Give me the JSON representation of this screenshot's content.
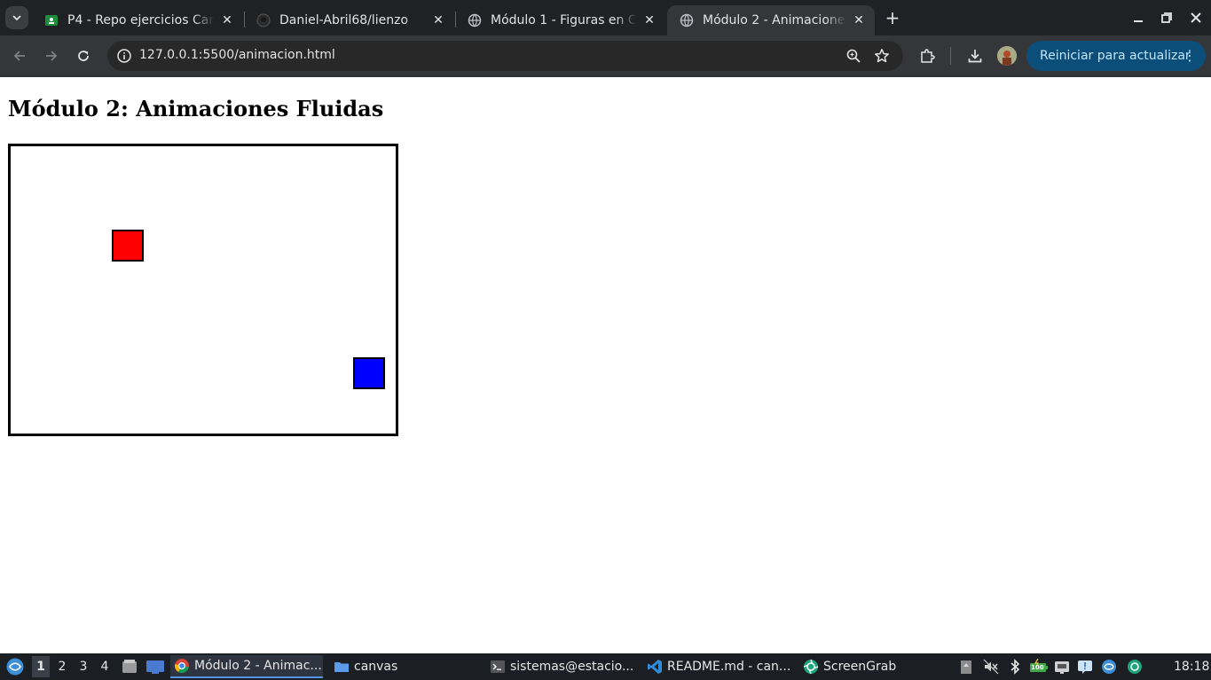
{
  "browser": {
    "tabs": [
      {
        "title": "P4 - Repo ejercicios Canv",
        "icon": "classroom-icon",
        "active": false
      },
      {
        "title": "Daniel-Abril68/lienzo",
        "icon": "github-icon",
        "active": false
      },
      {
        "title": "Módulo 1 - Figuras en Ca",
        "icon": "globe-icon",
        "active": false
      },
      {
        "title": "Módulo 2 - Animaciones",
        "icon": "globe-icon",
        "active": true
      }
    ],
    "url": "127.0.0.1:5500/animacion.html",
    "restart_button": "Reiniciar para actualizar"
  },
  "page": {
    "title": "Módulo 2: Animaciones Fluidas",
    "canvas": {
      "squares": [
        {
          "name": "red-square",
          "color": "#ff0000"
        },
        {
          "name": "blue-square",
          "color": "#0000ff"
        }
      ]
    }
  },
  "taskbar": {
    "workspaces": [
      "1",
      "2",
      "3",
      "4"
    ],
    "tasks": [
      {
        "label": "Módulo 2 - Animac...",
        "icon": "chrome-icon",
        "active": true
      },
      {
        "label": "canvas",
        "icon": "folder-icon",
        "active": false
      },
      {
        "label": "sistemas@estacio...",
        "icon": "terminal-icon",
        "active": false
      },
      {
        "label": "README.md - can...",
        "icon": "vscode-icon",
        "active": false
      },
      {
        "label": "ScreenGrab",
        "icon": "screengrab-icon",
        "active": false
      }
    ],
    "battery_label": "100",
    "clock": "18:18"
  }
}
